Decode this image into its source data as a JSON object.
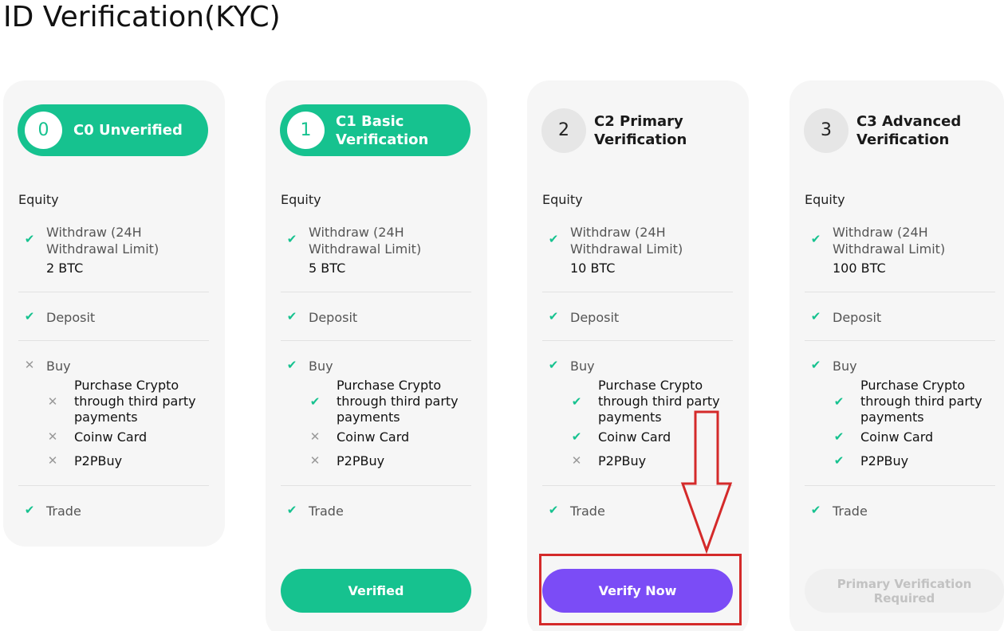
{
  "page": {
    "title": "ID Verification(KYC)"
  },
  "common": {
    "equity_label": "Equity",
    "withdraw_label": "Withdraw (24H Withdrawal Limit)",
    "deposit_label": "Deposit",
    "buy_label": "Buy",
    "purchase_label": "Purchase Crypto through third party payments",
    "card_label": "Coinw Card",
    "p2p_label": "P2PBuy",
    "trade_label": "Trade"
  },
  "levels": [
    {
      "number": "0",
      "name": "C0 Unverified",
      "active": true,
      "withdraw_limit": "2 BTC",
      "withdraw": "check-icon",
      "deposit": "check-icon",
      "buy": "cross-icon",
      "purchase": "cross-icon",
      "card": "cross-icon",
      "p2p": "cross-icon",
      "trade": "check-icon",
      "action": ""
    },
    {
      "number": "1",
      "name": "C1 Basic Verification",
      "active": true,
      "withdraw_limit": "5 BTC",
      "withdraw": "check-icon",
      "deposit": "check-icon",
      "buy": "check-icon",
      "purchase": "check-icon",
      "card": "cross-icon",
      "p2p": "cross-icon",
      "trade": "check-icon",
      "action": "Verified"
    },
    {
      "number": "2",
      "name": "C2 Primary Verification",
      "active": false,
      "withdraw_limit": "10 BTC",
      "withdraw": "check-icon",
      "deposit": "check-icon",
      "buy": "check-icon",
      "purchase": "check-icon",
      "card": "check-icon",
      "p2p": "cross-icon",
      "trade": "check-icon",
      "action": "Verify Now"
    },
    {
      "number": "3",
      "name": "C3 Advanced Verification",
      "active": false,
      "withdraw_limit": "100 BTC",
      "withdraw": "check-icon",
      "deposit": "check-icon",
      "buy": "check-icon",
      "purchase": "check-icon",
      "card": "check-icon",
      "p2p": "check-icon",
      "trade": "check-icon",
      "action": "Primary Verification Required"
    }
  ],
  "colors": {
    "accent_green": "#16c28f",
    "accent_purple": "#7b4cf6",
    "annotation_red": "#d42a2a",
    "card_bg": "#f6f6f6"
  }
}
